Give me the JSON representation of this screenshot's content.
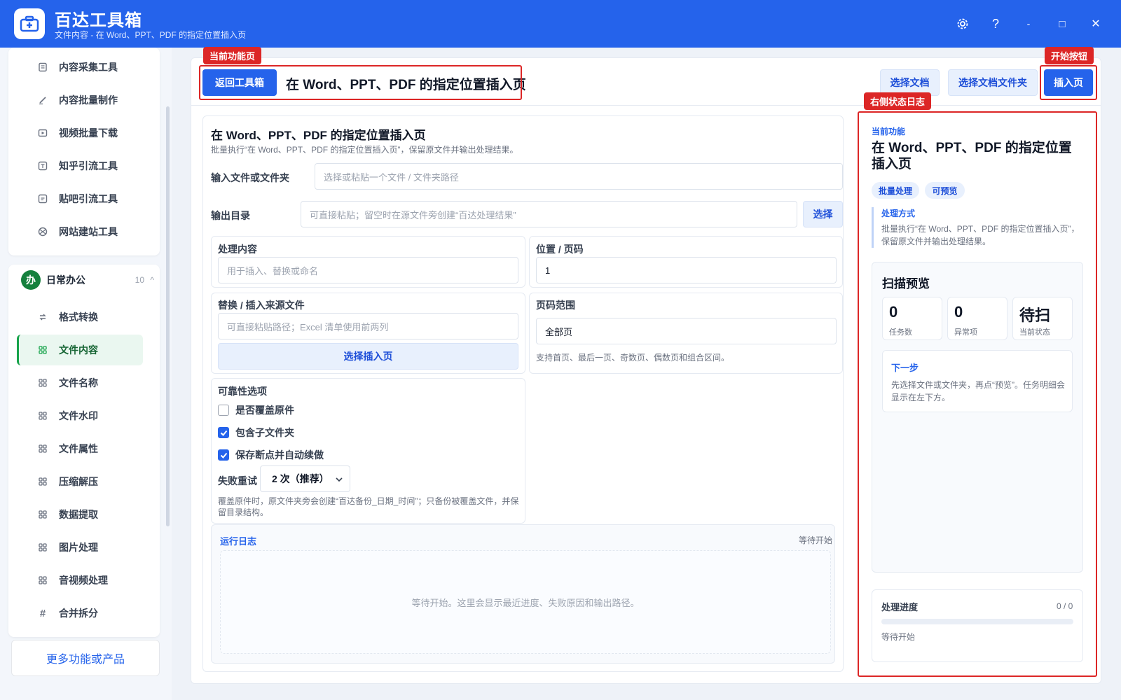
{
  "app": {
    "title": "百达工具箱",
    "subtitle": "文件内容 - 在 Word、PPT、PDF 的指定位置插入页"
  },
  "window_controls": {
    "settings": "settings-icon",
    "help": "?",
    "minimize": "-",
    "maximize": "□",
    "close": "✕"
  },
  "sidebar": {
    "top_items": [
      {
        "label": "内容采集工具",
        "icon": "doc-icon"
      },
      {
        "label": "内容批量制作",
        "icon": "pen-icon"
      },
      {
        "label": "视频批量下载",
        "icon": "video-icon"
      },
      {
        "label": "知乎引流工具",
        "icon": "zhihu-icon"
      },
      {
        "label": "贴吧引流工具",
        "icon": "tieba-icon"
      },
      {
        "label": "网站建站工具",
        "icon": "globe-icon"
      }
    ],
    "group": {
      "badge": "办",
      "name": "日常办公",
      "count": "10",
      "chevron": "^"
    },
    "group_items": [
      {
        "label": "格式转换",
        "icon": "convert-icon"
      },
      {
        "label": "文件内容",
        "icon": "grid-icon",
        "active": true
      },
      {
        "label": "文件名称",
        "icon": "grid-icon"
      },
      {
        "label": "文件水印",
        "icon": "grid-icon"
      },
      {
        "label": "文件属性",
        "icon": "grid-icon"
      },
      {
        "label": "压缩解压",
        "icon": "grid-icon"
      },
      {
        "label": "数据提取",
        "icon": "grid-icon"
      },
      {
        "label": "图片处理",
        "icon": "grid-icon"
      },
      {
        "label": "音视频处理",
        "icon": "grid-icon"
      },
      {
        "label": "合并拆分",
        "icon": "hash-icon"
      }
    ],
    "more_button": "更多功能或产品"
  },
  "topbar": {
    "back_button": "返回工具箱",
    "heading": "在 Word、PPT、PDF 的指定位置插入页",
    "select_doc": "选择文档",
    "select_folder": "选择文档文件夹",
    "start_button": "插入页"
  },
  "annotations": {
    "current_page": "当前功能页",
    "start_button": "开始按钮",
    "right_log": "右侧状态日志"
  },
  "form": {
    "title": "在 Word、PPT、PDF 的指定位置插入页",
    "description": "批量执行“在 Word、PPT、PDF 的指定位置插入页”，保留原文件并输出处理结果。",
    "input_label": "输入文件或文件夹",
    "input_placeholder": "选择或粘贴一个文件 / 文件夹路径",
    "output_label": "输出目录",
    "output_placeholder": "可直接粘贴；留空时在源文件旁创建“百达处理结果”",
    "output_button": "选择",
    "content_label": "处理内容",
    "content_placeholder": "用于插入、替换或命名",
    "position_label": "位置 / 页码",
    "position_value": "1",
    "source_label": "替换 / 插入来源文件",
    "source_placeholder": "可直接粘贴路径；Excel 清单使用前两列",
    "source_button": "选择插入页",
    "range_label": "页码范围",
    "range_value": "全部页",
    "range_note": "支持首页、最后一页、奇数页、偶数页和组合区间。",
    "reliability_label": "可靠性选项",
    "options": [
      {
        "label": "是否覆盖原件",
        "checked": false
      },
      {
        "label": "包含子文件夹",
        "checked": true
      },
      {
        "label": "保存断点并自动续做",
        "checked": true
      }
    ],
    "retry_label": "失败重试",
    "retry_value": "2 次（推荐）",
    "overwrite_note": "覆盖原件时，原文件夹旁会创建“百达备份_日期_时间”；只备份被覆盖文件，并保留目录结构。"
  },
  "log": {
    "title": "运行日志",
    "status": "等待开始",
    "empty_text": "等待开始。这里会显示最近进度、失败原因和输出路径。"
  },
  "right_panel": {
    "current_label": "当前功能",
    "title": "在 Word、PPT、PDF 的指定位置插入页",
    "chips": [
      "批量处理",
      "可预览"
    ],
    "method_label": "处理方式",
    "method_text": "批量执行“在 Word、PPT、PDF 的指定位置插入页”，保留原文件并输出处理结果。",
    "scan_title": "扫描预览",
    "stats": [
      {
        "value": "0",
        "caption": "任务数"
      },
      {
        "value": "0",
        "caption": "异常项"
      },
      {
        "value": "待扫",
        "caption": "当前状态"
      }
    ],
    "next_label": "下一步",
    "next_text": "先选择文件或文件夹，再点“预览”。任务明细会显示在左下方。",
    "progress_label": "处理进度",
    "progress_count": "0 / 0",
    "progress_fraction": 0,
    "progress_status": "等待开始"
  },
  "colors": {
    "brand": "#2563eb",
    "annotation": "#dc2626",
    "active_green": "#16a34a"
  }
}
